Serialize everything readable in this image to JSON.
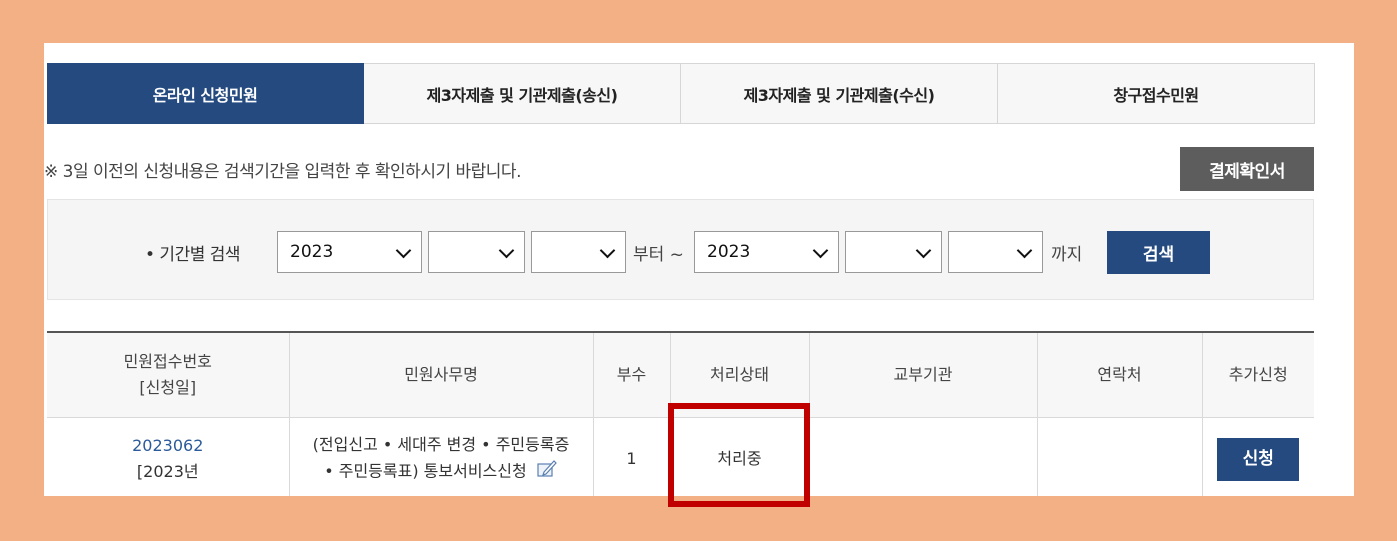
{
  "tabs": [
    {
      "label": "온라인 신청민원",
      "active": true
    },
    {
      "label": "제3자제출 및 기관제출(송신)",
      "active": false
    },
    {
      "label": "제3자제출 및 기관제출(수신)",
      "active": false
    },
    {
      "label": "창구접수민원",
      "active": false
    }
  ],
  "notice": "※ 3일 이전의 신청내용은 검색기간을 입력한 후 확인하시기 바랍니다.",
  "confirm_button": "결제확인서",
  "search": {
    "label": "• 기간별 검색",
    "from_year": "2023",
    "from_month": "",
    "from_day": "",
    "from_text": "부터 ~",
    "to_year": "2023",
    "to_month": "",
    "to_day": "",
    "to_text": "까지",
    "button": "검색"
  },
  "table": {
    "headers": [
      "민원접수번호",
      "[신청일]",
      "민원사무명",
      "부수",
      "처리상태",
      "교부기관",
      "연락처",
      "추가신청"
    ],
    "row": {
      "number": "2023062",
      "date": "[2023년",
      "name_line1": "(전입신고 • 세대주 변경 • 주민등록증",
      "name_line2": "• 주민등록표) 통보서비스신청",
      "copies": "1",
      "status": "처리중",
      "agency": "",
      "contact": "",
      "apply_button": "신청"
    }
  },
  "colors": {
    "frame": "#f2b084",
    "navy": "#244a80",
    "highlight": "#c00000"
  }
}
